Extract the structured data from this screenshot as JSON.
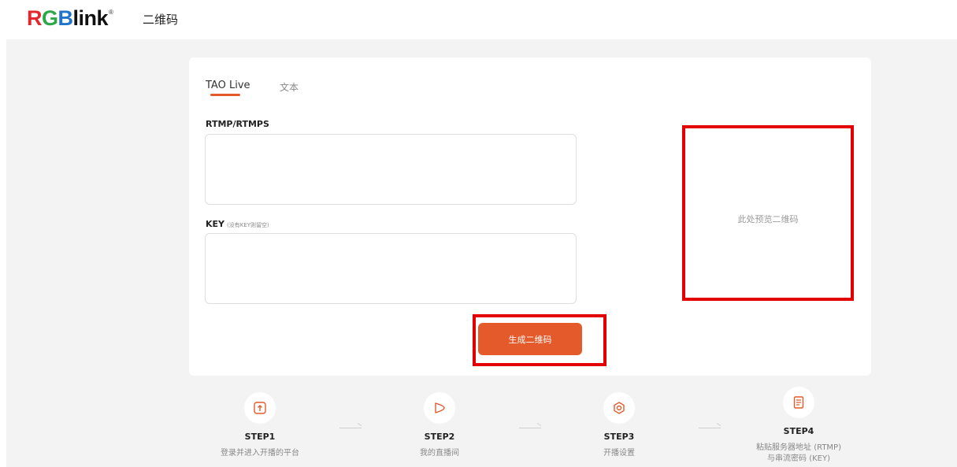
{
  "header": {
    "logo": {
      "r": "R",
      "g": "G",
      "b": "B",
      "link": "link",
      "reg": "®"
    },
    "title": "二维码"
  },
  "tabs": [
    {
      "label": "TAO Live",
      "active": true
    },
    {
      "label": "文本",
      "active": false
    }
  ],
  "form": {
    "rtmp_label": "RTMP/RTMPS",
    "rtmp_value": "",
    "key_label": "KEY",
    "key_hint": "(没有KEY则留空)",
    "key_value": "",
    "generate_label": "生成二维码"
  },
  "preview": {
    "placeholder": "此处预览二维码"
  },
  "steps": [
    {
      "title": "STEP1",
      "desc": "登录并进入开播的平台",
      "icon": "upload-icon"
    },
    {
      "title": "STEP2",
      "desc": "我的直播间",
      "icon": "live-icon"
    },
    {
      "title": "STEP3",
      "desc": "开播设置",
      "icon": "settings-icon"
    },
    {
      "title": "STEP4",
      "desc_line1": "粘贴服务器地址 (RTMP)",
      "desc_line2": "与串流密码 (KEY)",
      "icon": "document-icon"
    }
  ],
  "colors": {
    "accent": "#e55a2b",
    "highlight": "#e30000"
  }
}
